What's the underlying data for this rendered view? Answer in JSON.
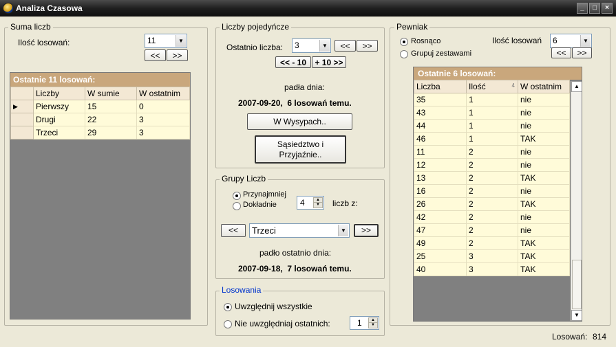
{
  "window": {
    "title": "Analiza Czasowa",
    "min": "_",
    "max": "□",
    "close": "×"
  },
  "suma": {
    "title": "Suma liczb",
    "count_label": "Ilość losowań:",
    "count_value": "11",
    "prev": "<<",
    "next": ">>",
    "grid_caption": "Ostatnie 11 losowań:",
    "columns": [
      "Liczby",
      "W sumie",
      "W ostatnim"
    ],
    "rows": [
      {
        "label": "Pierwszy",
        "sum": "15",
        "last": "0",
        "current": true
      },
      {
        "label": "Drugi",
        "sum": "22",
        "last": "3"
      },
      {
        "label": "Trzeci",
        "sum": "29",
        "last": "3"
      }
    ]
  },
  "single": {
    "title": "Liczby pojedyńcze",
    "recent_label": "Ostatnio liczba:",
    "recent_value": "3",
    "prev": "<<",
    "next": ">>",
    "minus10": "<< - 10",
    "plus10": "+ 10 >>",
    "fell_label": "padła dnia:",
    "fell_date": "2007-09-20,  6 losowań temu.",
    "islands_button": "W Wysypach..",
    "neighbors_button": "Sąsiedztwo i Przyjaźnie.."
  },
  "groups": {
    "title": "Grupy Liczb",
    "at_least": "Przynajmniej",
    "exactly": "Dokładnie",
    "count_value": "4",
    "numbers_of": "liczb z:",
    "prev": "<<",
    "next": ">>",
    "selected": "Trzeci",
    "fell_label": "padło ostatnio dnia:",
    "fell_date": "2007-09-18,  7 losowań temu."
  },
  "draws": {
    "title": "Losowania",
    "include_all": "Uwzględnij wszystkie",
    "exclude_last": "Nie uwzględniaj ostatnich:",
    "exclude_value": "1"
  },
  "pewniak": {
    "title": "Pewniak",
    "ascending": "Rosnąco",
    "group_sets": "Grupuj zestawami",
    "count_label": "Ilość losowań",
    "count_value": "6",
    "prev": "<<",
    "next": ">>",
    "grid_caption": "Ostatnie 6 losowań:",
    "columns": [
      "Liczba",
      "Ilość",
      "W ostatnim"
    ],
    "sort_indicator": "4",
    "rows": [
      [
        "35",
        "1",
        "nie"
      ],
      [
        "43",
        "1",
        "nie"
      ],
      [
        "44",
        "1",
        "nie"
      ],
      [
        "46",
        "1",
        "TAK"
      ],
      [
        "11",
        "2",
        "nie"
      ],
      [
        "12",
        "2",
        "nie"
      ],
      [
        "13",
        "2",
        "TAK"
      ],
      [
        "16",
        "2",
        "nie"
      ],
      [
        "26",
        "2",
        "TAK"
      ],
      [
        "42",
        "2",
        "nie"
      ],
      [
        "47",
        "2",
        "nie"
      ],
      [
        "49",
        "2",
        "TAK"
      ],
      [
        "25",
        "3",
        "TAK"
      ],
      [
        "40",
        "3",
        "TAK"
      ]
    ]
  },
  "status": {
    "draws_label": "Losowań:",
    "draws_value": "814"
  }
}
